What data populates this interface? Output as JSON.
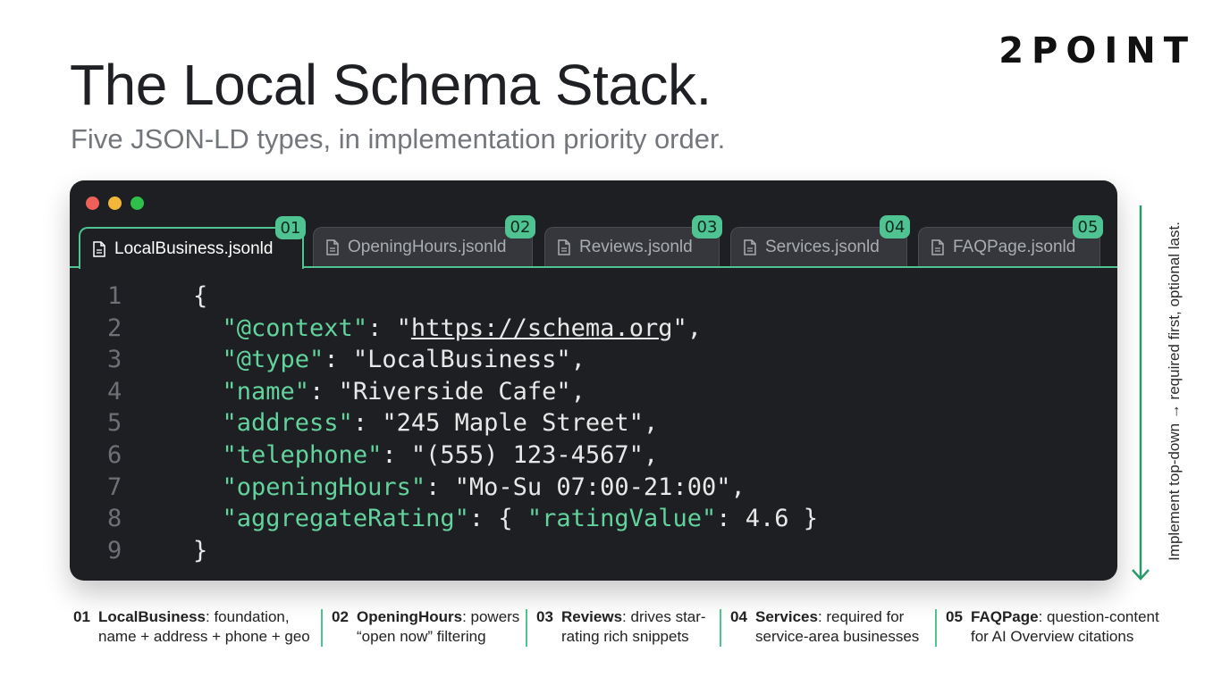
{
  "brand": "2POINT",
  "title": "The Local Schema Stack.",
  "subtitle": "Five JSON-LD types, in implementation priority order.",
  "colors": {
    "accent": "#4fc392",
    "editor_bg": "#1e1f22",
    "tab_bg": "#35373c",
    "key_color": "#63d39e"
  },
  "tabs": [
    {
      "badge": "01",
      "label": "LocalBusiness.jsonld",
      "active": true
    },
    {
      "badge": "02",
      "label": "OpeningHours.jsonld",
      "active": false
    },
    {
      "badge": "03",
      "label": "Reviews.jsonld",
      "active": false
    },
    {
      "badge": "04",
      "label": "Services.jsonld",
      "active": false
    },
    {
      "badge": "05",
      "label": "FAQPage.jsonld",
      "active": false
    }
  ],
  "code": {
    "line_numbers": [
      "1",
      "2",
      "3",
      "4",
      "5",
      "6",
      "7",
      "8",
      "9"
    ],
    "open_brace": "{",
    "close_brace": "}",
    "context_key": "\"@context\"",
    "context_url": "https://schema.org",
    "type_key": "\"@type\"",
    "type_val": "\"LocalBusiness\"",
    "name_key": "\"name\"",
    "name_val": "\"Riverside Cafe\"",
    "address_key": "\"address\"",
    "address_val": "\"245 Maple Street\"",
    "telephone_key": "\"telephone\"",
    "telephone_val": "\"(555) 123-4567\"",
    "hours_key": "\"openingHours\"",
    "hours_val": "\"Mo-Su 07:00-21:00\"",
    "rating_key": "\"aggregateRating\"",
    "rating_inner_key": "\"ratingValue\"",
    "rating_val": "4.6"
  },
  "side_note": "Implement top-down → required first, optional last.",
  "captions": [
    {
      "num": "01",
      "title": "LocalBusiness",
      "line1": ": foundation,",
      "line2": "name + address + phone + geo"
    },
    {
      "num": "02",
      "title": "OpeningHours",
      "line1": ": powers",
      "line2": "“open now” filtering"
    },
    {
      "num": "03",
      "title": "Reviews",
      "line1": ": drives star-",
      "line2": "rating rich snippets"
    },
    {
      "num": "04",
      "title": "Services",
      "line1": ": required for",
      "line2": "service-area businesses"
    },
    {
      "num": "05",
      "title": "FAQPage",
      "line1": ": question-content",
      "line2": "for AI Overview citations"
    }
  ]
}
